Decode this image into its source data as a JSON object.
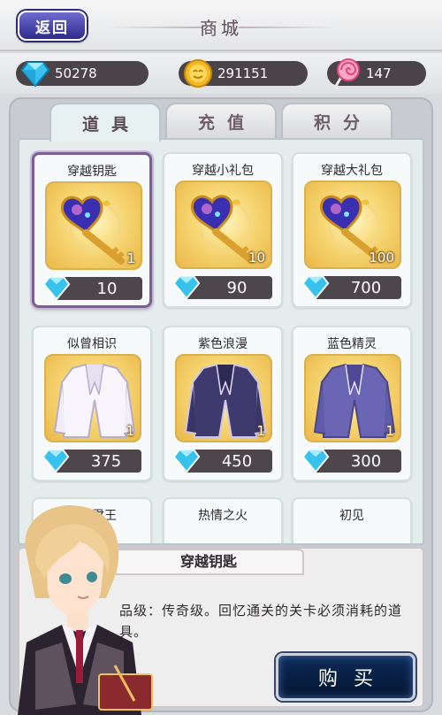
{
  "header": {
    "back_label": "返回",
    "title": "商城"
  },
  "currencies": {
    "diamonds": {
      "icon": "diamond-icon",
      "value": "50278"
    },
    "coins": {
      "icon": "gold-coin-icon",
      "value": "291151"
    },
    "candy": {
      "icon": "lollipop-icon",
      "value": "147"
    }
  },
  "tabs": [
    {
      "label": "道具",
      "active": true
    },
    {
      "label": "充值",
      "active": false
    },
    {
      "label": "积分",
      "active": false
    }
  ],
  "items": [
    {
      "name": "穿越钥匙",
      "icon": "heart-key-icon",
      "qty": "1",
      "price": "10",
      "selected": true
    },
    {
      "name": "穿越小礼包",
      "icon": "heart-key-icon",
      "qty": "10",
      "price": "90",
      "selected": false
    },
    {
      "name": "穿越大礼包",
      "icon": "heart-key-icon",
      "qty": "100",
      "price": "700",
      "selected": false
    },
    {
      "name": "似曾相识",
      "icon": "white-jacket-icon",
      "qty": "1",
      "price": "375",
      "selected": false
    },
    {
      "name": "紫色浪漫",
      "icon": "purple-jacket-icon",
      "qty": "1",
      "price": "450",
      "selected": false
    },
    {
      "name": "蓝色精灵",
      "icon": "blue-purple-jacket-icon",
      "qty": "1",
      "price": "300",
      "selected": false
    },
    {
      "name": "暗夜君王",
      "icon": "",
      "qty": "",
      "price": "",
      "selected": false
    },
    {
      "name": "热情之火",
      "icon": "",
      "qty": "",
      "price": "",
      "selected": false
    },
    {
      "name": "初见",
      "icon": "",
      "qty": "",
      "price": "",
      "selected": false
    }
  ],
  "detail": {
    "name": "穿越钥匙",
    "description": "品级：传奇级。回忆通关的关卡必须消耗的道具。",
    "buy_label": "购买"
  },
  "colors": {
    "diamond": "#37c3ee",
    "coin": "#f2b925",
    "candy": "#e85a8c",
    "selected_border": "#7a5f92",
    "price_pill": "#4d474b"
  }
}
